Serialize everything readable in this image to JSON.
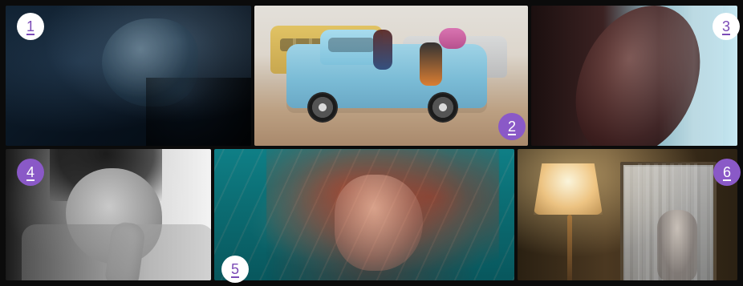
{
  "colors": {
    "badge_white_bg": "#ffffff",
    "badge_white_text": "#7b4bb6",
    "badge_purple_bg": "#8a59c7",
    "badge_purple_text": "#ffffff"
  },
  "tiles": [
    {
      "badge_label": "1",
      "badge_style": "white"
    },
    {
      "badge_label": "2",
      "badge_style": "purple"
    },
    {
      "badge_label": "3",
      "badge_style": "white"
    },
    {
      "badge_label": "4",
      "badge_style": "purple"
    },
    {
      "badge_label": "5",
      "badge_style": "white"
    },
    {
      "badge_label": "6",
      "badge_style": "purple"
    }
  ]
}
